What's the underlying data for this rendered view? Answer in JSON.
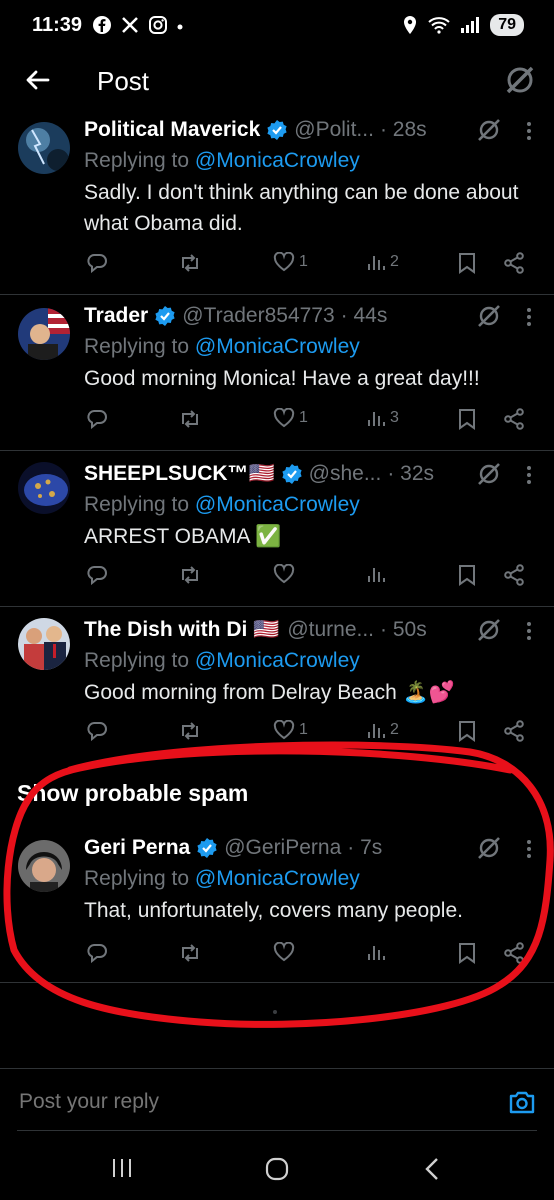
{
  "status_bar": {
    "time": "11:39",
    "battery": "79"
  },
  "header": {
    "title": "Post"
  },
  "posts": [
    {
      "name": "Political Maverick",
      "handle": "@Polit...",
      "time": "· 28s",
      "replying_prefix": "Replying to ",
      "replying_to": "@MonicaCrowley",
      "text": "Sadly. I don't think anything can be done about what Obama did.",
      "likes": "1",
      "views": "2"
    },
    {
      "name": "Trader",
      "handle": "@Trader854773",
      "time": "· 44s",
      "replying_prefix": "Replying to ",
      "replying_to": "@MonicaCrowley",
      "text": "Good morning Monica! Have a great day!!!",
      "likes": "1",
      "views": "3"
    },
    {
      "name": "SHEEPLSUCK™🇺🇸",
      "handle": "@she...",
      "time": "· 32s",
      "replying_prefix": "Replying to ",
      "replying_to": "@MonicaCrowley",
      "text": "ARREST OBAMA ✅",
      "likes": "",
      "views": ""
    },
    {
      "name": "The Dish with Di 🇺🇸",
      "handle": "@turne...",
      "time": "· 50s",
      "replying_prefix": "Replying to ",
      "replying_to": "@MonicaCrowley",
      "text": "Good morning from Delray Beach 🏝️💕",
      "likes": "1",
      "views": "2"
    },
    {
      "name": "Geri Perna",
      "handle": "@GeriPerna",
      "time": "· 7s",
      "replying_prefix": "Replying to ",
      "replying_to": "@MonicaCrowley",
      "text": "That, unfortunately, covers many people.",
      "likes": "",
      "views": ""
    }
  ],
  "spam_section": {
    "label": "Show probable spam"
  },
  "reply": {
    "placeholder": "Post your reply"
  },
  "colors": {
    "accent": "#1d9bf0",
    "muted": "#71767b",
    "highlight": "#e8101a"
  }
}
